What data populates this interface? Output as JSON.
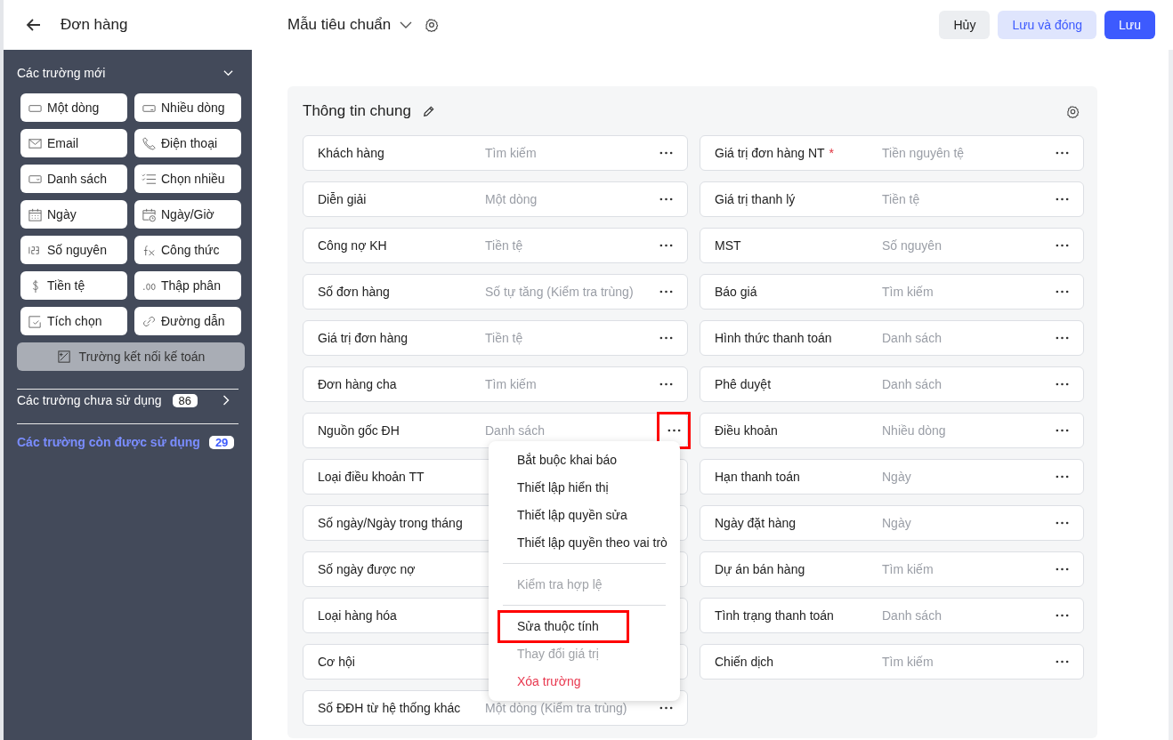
{
  "header": {
    "back_title": "Đơn hàng",
    "template": "Mẫu tiêu chuẩn",
    "buttons": [
      {
        "label": "Hủy",
        "kind": "plain"
      },
      {
        "label": "Lưu và đóng",
        "kind": "soft"
      },
      {
        "label": "Lưu",
        "kind": "primary"
      }
    ]
  },
  "sidebar": {
    "new_fields_title": "Các trường mới",
    "expanded": true,
    "field_types": [
      {
        "label": "Một dòng",
        "kind": "single"
      },
      {
        "label": "Nhiều dòng",
        "kind": "multi"
      },
      {
        "label": "Email",
        "kind": "email"
      },
      {
        "label": "Điện thoại",
        "kind": "phone"
      },
      {
        "label": "Danh sách",
        "kind": "list"
      },
      {
        "label": "Chọn nhiều",
        "kind": "multiselect"
      },
      {
        "label": "Ngày",
        "kind": "date"
      },
      {
        "label": "Ngày/Giờ",
        "kind": "datetime"
      },
      {
        "label": "Số nguyên",
        "kind": "integer"
      },
      {
        "label": "Công thức",
        "kind": "formula"
      },
      {
        "label": "Tiền tệ",
        "kind": "currency"
      },
      {
        "label": "Thập phân",
        "kind": "decimal"
      },
      {
        "label": "Tích chọn",
        "kind": "checkbox"
      },
      {
        "label": "Đường dẫn",
        "kind": "link"
      }
    ],
    "accounting_button": "Trường kết nối kế toán",
    "unused": {
      "label": "Các trường chưa sử dụng",
      "count": "86"
    },
    "available": {
      "label": "Các trường còn được sử dụng",
      "count": "29"
    }
  },
  "card": {
    "title": "Thông tin chung",
    "left_rows": [
      {
        "label": "Khách hàng",
        "value": "Tìm kiếm",
        "menu_open": false
      },
      {
        "label": "Diễn giải",
        "value": "Một dòng",
        "menu_open": false
      },
      {
        "label": "Công nợ KH",
        "value": "Tiền tệ",
        "menu_open": false
      },
      {
        "label": "Số đơn hàng",
        "value": "Số tự tăng (Kiểm tra trùng)",
        "menu_open": false
      },
      {
        "label": "Giá trị đơn hàng",
        "value": "Tiền tệ",
        "menu_open": false
      },
      {
        "label": "Đơn hàng cha",
        "value": "Tìm kiếm",
        "menu_open": false
      },
      {
        "label": "Nguồn gốc ĐH",
        "value": "Danh sách",
        "menu_open": true
      },
      {
        "label": "Loại điều khoản TT",
        "menu_open": false
      },
      {
        "label": "Số ngày/Ngày trong tháng",
        "menu_open": false
      },
      {
        "label": "Số ngày được nợ",
        "menu_open": false
      },
      {
        "label": "Loại hàng hóa",
        "menu_open": false
      },
      {
        "label": "Cơ hội",
        "menu_open": false
      },
      {
        "label": "Số ĐĐH từ hệ thống khác",
        "value": "Một dòng (Kiểm tra trùng)",
        "menu_open": false
      }
    ],
    "right_rows": [
      {
        "label": "Giá trị đơn hàng NT",
        "required_mark": "*",
        "value": "Tiền nguyên tệ",
        "menu_open": false
      },
      {
        "label": "Giá trị thanh lý",
        "value": "Tiền tệ",
        "menu_open": false
      },
      {
        "label": "MST",
        "value": "Số nguyên",
        "menu_open": false
      },
      {
        "label": "Báo giá",
        "value": "Tìm kiếm",
        "menu_open": false
      },
      {
        "label": "Hình thức thanh toán",
        "value": "Danh sách",
        "menu_open": false
      },
      {
        "label": "Phê duyệt",
        "value": "Danh sách",
        "menu_open": false
      },
      {
        "label": "Điều khoản",
        "value": "Nhiều dòng",
        "menu_open": false
      },
      {
        "label": "Hạn thanh toán",
        "value": "Ngày",
        "menu_open": false
      },
      {
        "label": "Ngày đặt hàng",
        "value": "Ngày",
        "menu_open": false
      },
      {
        "label": "Dự án bán hàng",
        "value": "Tìm kiếm",
        "menu_open": false
      },
      {
        "label": "Tình trạng thanh toán",
        "value": "Danh sách",
        "menu_open": false
      },
      {
        "label": "Chiến dịch",
        "value": "Tìm kiếm",
        "menu_open": false
      }
    ]
  },
  "field_menu": {
    "groups": [
      [
        {
          "label": "Bắt buộc khai báo",
          "disabled": false,
          "kind": "normal",
          "highlighted": false
        },
        {
          "label": "Thiết lập hiển thị",
          "disabled": false,
          "kind": "normal",
          "highlighted": false
        },
        {
          "label": "Thiết lập quyền sửa",
          "disabled": false,
          "kind": "normal",
          "highlighted": false
        },
        {
          "label": "Thiết lập quyền theo vai trò",
          "disabled": false,
          "kind": "normal",
          "highlighted": false
        }
      ],
      [
        {
          "label": "Kiểm tra hợp lệ",
          "disabled": true,
          "kind": "normal",
          "highlighted": false
        }
      ],
      [
        {
          "label": "Sửa thuộc tính",
          "disabled": false,
          "kind": "normal",
          "highlighted": true
        },
        {
          "label": "Thay đổi giá trị",
          "disabled": true,
          "kind": "normal",
          "highlighted": false
        },
        {
          "label": "Xóa trường",
          "disabled": false,
          "kind": "danger",
          "highlighted": false
        }
      ]
    ]
  }
}
